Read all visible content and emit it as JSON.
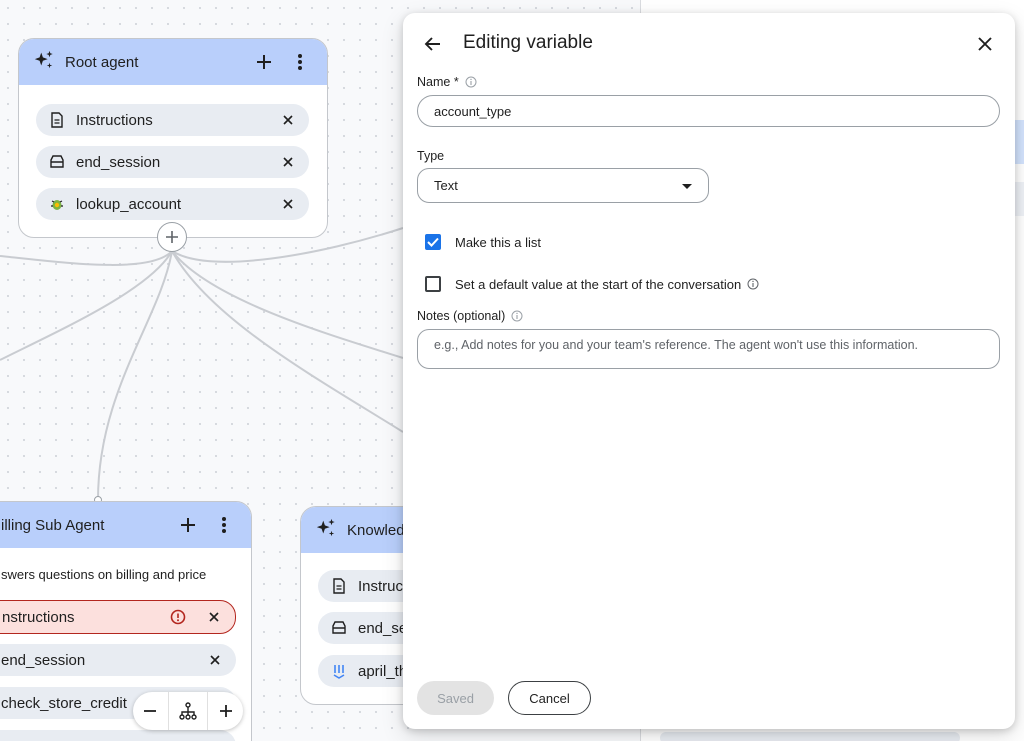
{
  "canvas": {
    "root_agent": {
      "title": "Root agent",
      "chips": [
        {
          "label": "Instructions",
          "icon": "document-icon"
        },
        {
          "label": "end_session",
          "icon": "tray-icon"
        },
        {
          "label": "lookup_account",
          "icon": "bug-icon"
        }
      ]
    },
    "billing_agent": {
      "title": "illing Sub Agent",
      "description": "swers questions on billing and price",
      "chips": [
        {
          "label": "nstructions",
          "icon": "error-icon",
          "status": "error"
        },
        {
          "label": "end_session"
        },
        {
          "label": "check_store_credit"
        }
      ]
    },
    "knowledge_agent": {
      "title": "Knowled",
      "chips": [
        {
          "label": "Instruct",
          "icon": "document-icon"
        },
        {
          "label": "end_ses",
          "icon": "tray-icon"
        },
        {
          "label": "april_th",
          "icon": "datastore-icon"
        }
      ]
    }
  },
  "dialog": {
    "title": "Editing variable",
    "name_label": "Name *",
    "name_value": "account_type",
    "type_label": "Type",
    "type_value": "Text",
    "make_list_label": "Make this a list",
    "make_list_checked": true,
    "default_value_label": "Set a default value at the start of the conversation",
    "default_value_checked": false,
    "notes_label": "Notes (optional)",
    "notes_placeholder": "e.g., Add notes for you and your team's reference. The agent won't use this information.",
    "saved_label": "Saved",
    "cancel_label": "Cancel"
  },
  "colors": {
    "node_header": "#b9cffb",
    "chip": "#e8ecf2",
    "error": "#b3261e",
    "checkbox_on": "#1a73e8"
  }
}
